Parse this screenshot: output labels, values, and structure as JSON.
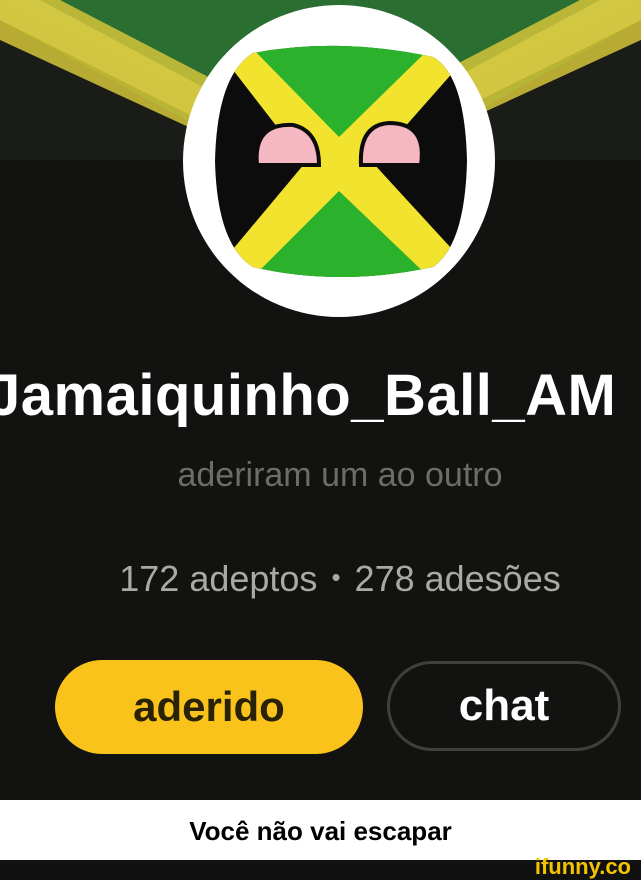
{
  "profile": {
    "username": "Jamaiquinho_Ball_AM",
    "subtitle": "aderiram um ao outro",
    "followers": "172 adeptos",
    "separator": "•",
    "following": "278 adesões"
  },
  "actions": {
    "joined_label": "aderido",
    "chat_label": "chat"
  },
  "caption": "Você não vai escapar",
  "watermark": "ifunny.co",
  "colors": {
    "background": "#121310",
    "accent_yellow": "#f9c31c",
    "flag_green": "#2bb12b",
    "flag_yellow": "#f2e32e"
  }
}
